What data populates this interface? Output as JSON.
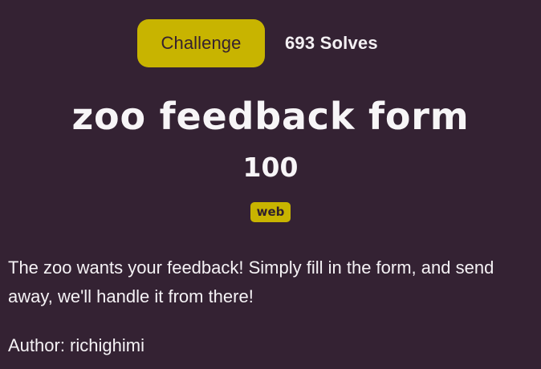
{
  "colors": {
    "background": "#342233",
    "accent": "#c8b400",
    "text": "#f4f1f4"
  },
  "tabs": {
    "challenge_label": "Challenge",
    "solves_label": "693 Solves"
  },
  "challenge": {
    "title": "zoo feedback form",
    "points": "100",
    "category": "web",
    "description": "The zoo wants your feedback! Simply fill in the form, and send away, we'll handle it from there!",
    "author": "Author: richighimi"
  }
}
